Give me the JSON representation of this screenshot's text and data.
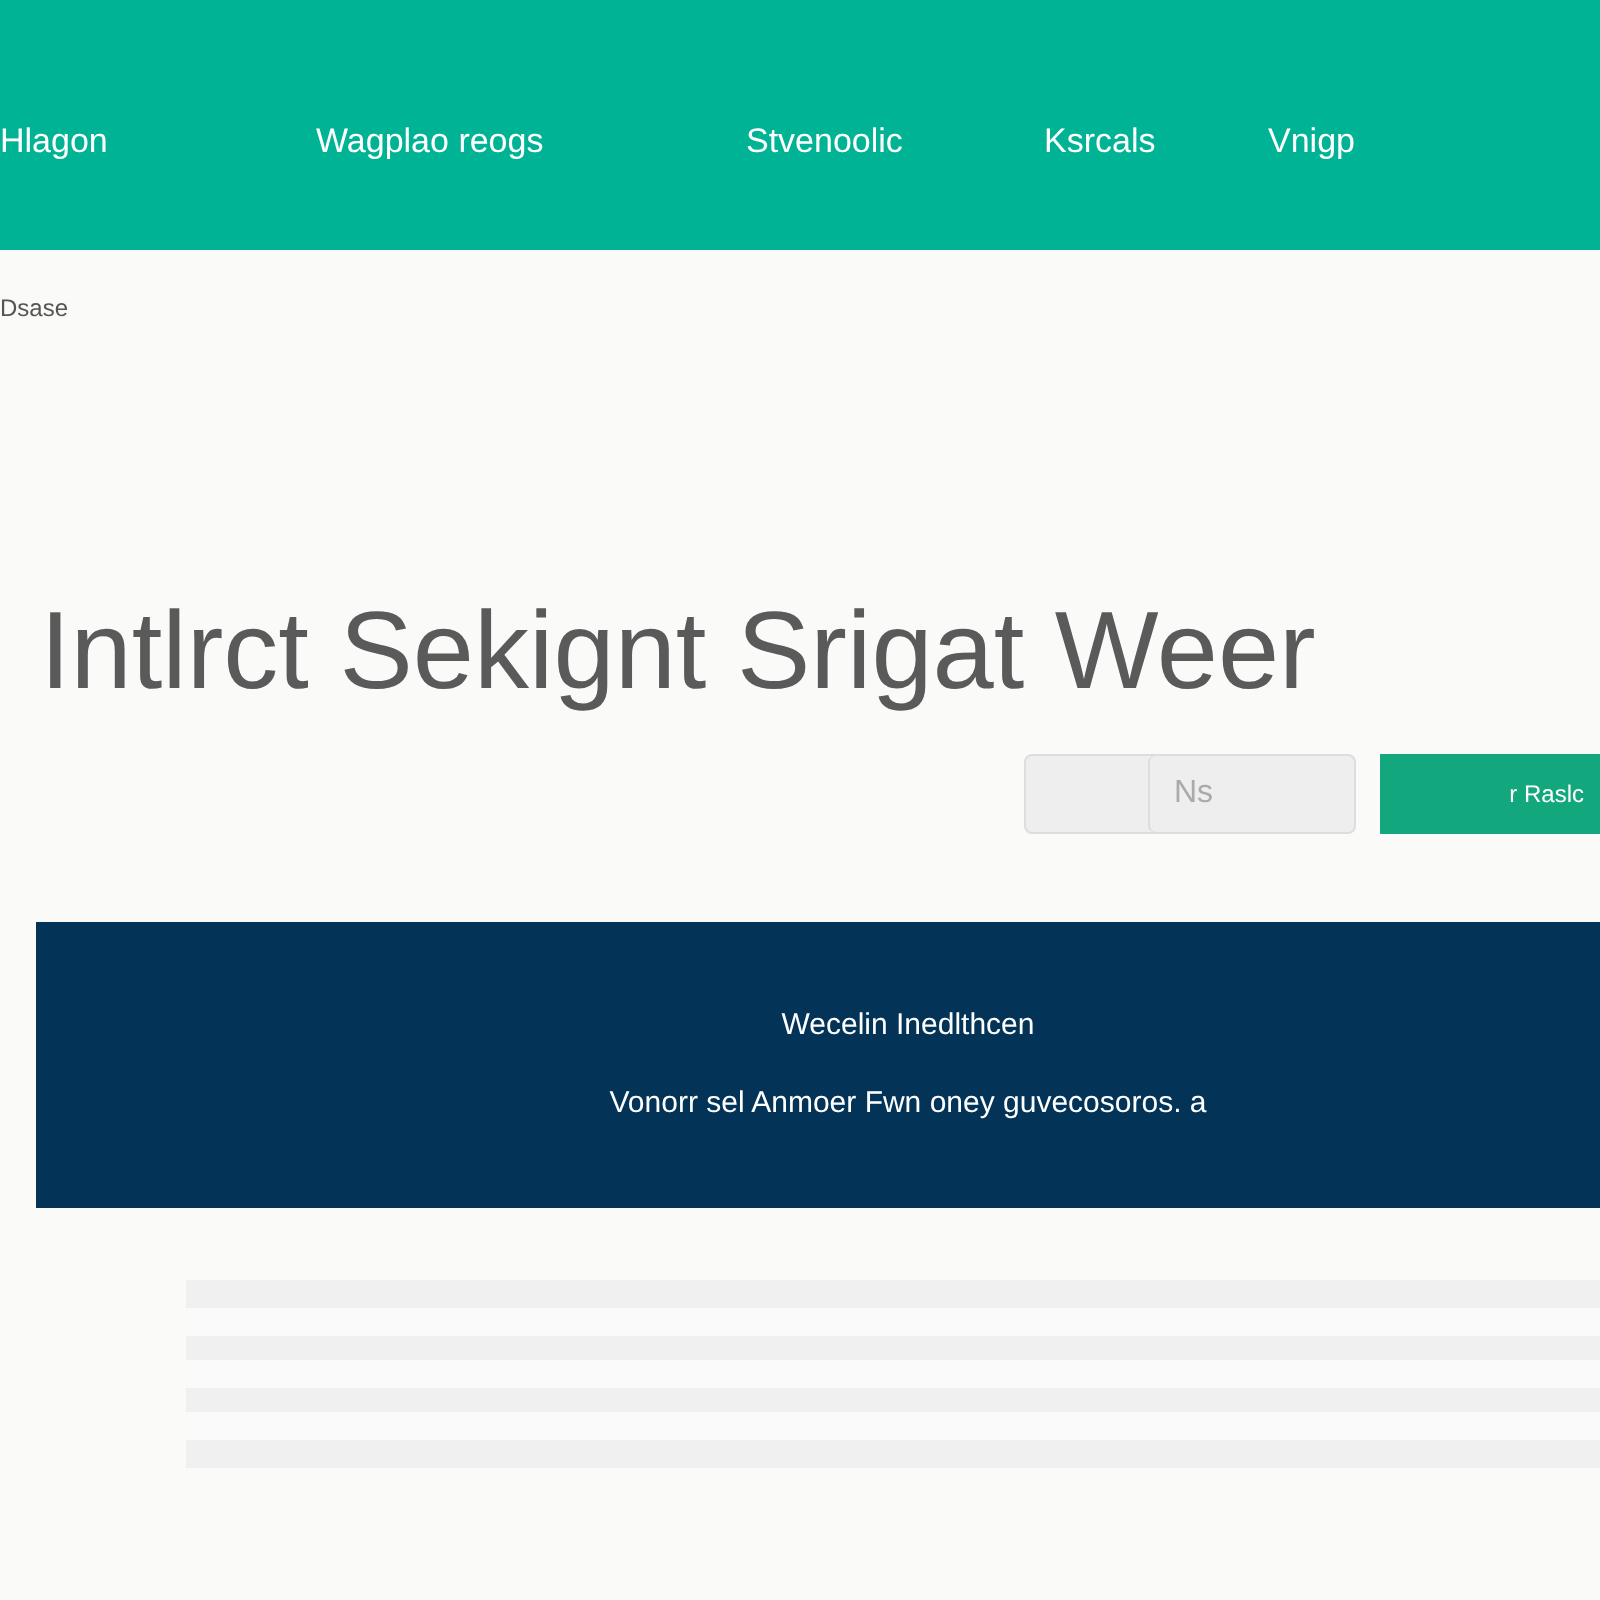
{
  "nav": {
    "items": [
      {
        "label": "Hlagon"
      },
      {
        "label": "Wagplao reogs"
      },
      {
        "label": "Stvenoolic"
      },
      {
        "label": "Ksrcals"
      },
      {
        "label": "Vnigp"
      }
    ]
  },
  "breadcrumb": "Dsase",
  "heading": "Intlrct Sekignt Srigat Weer",
  "search": {
    "placeholder": "Ns",
    "button": "r Raslc"
  },
  "banner": {
    "title": "Wecelin Inedlthcen",
    "text": "Vonorr sel Anmoer Fwn oney guvecosoros. a"
  }
}
